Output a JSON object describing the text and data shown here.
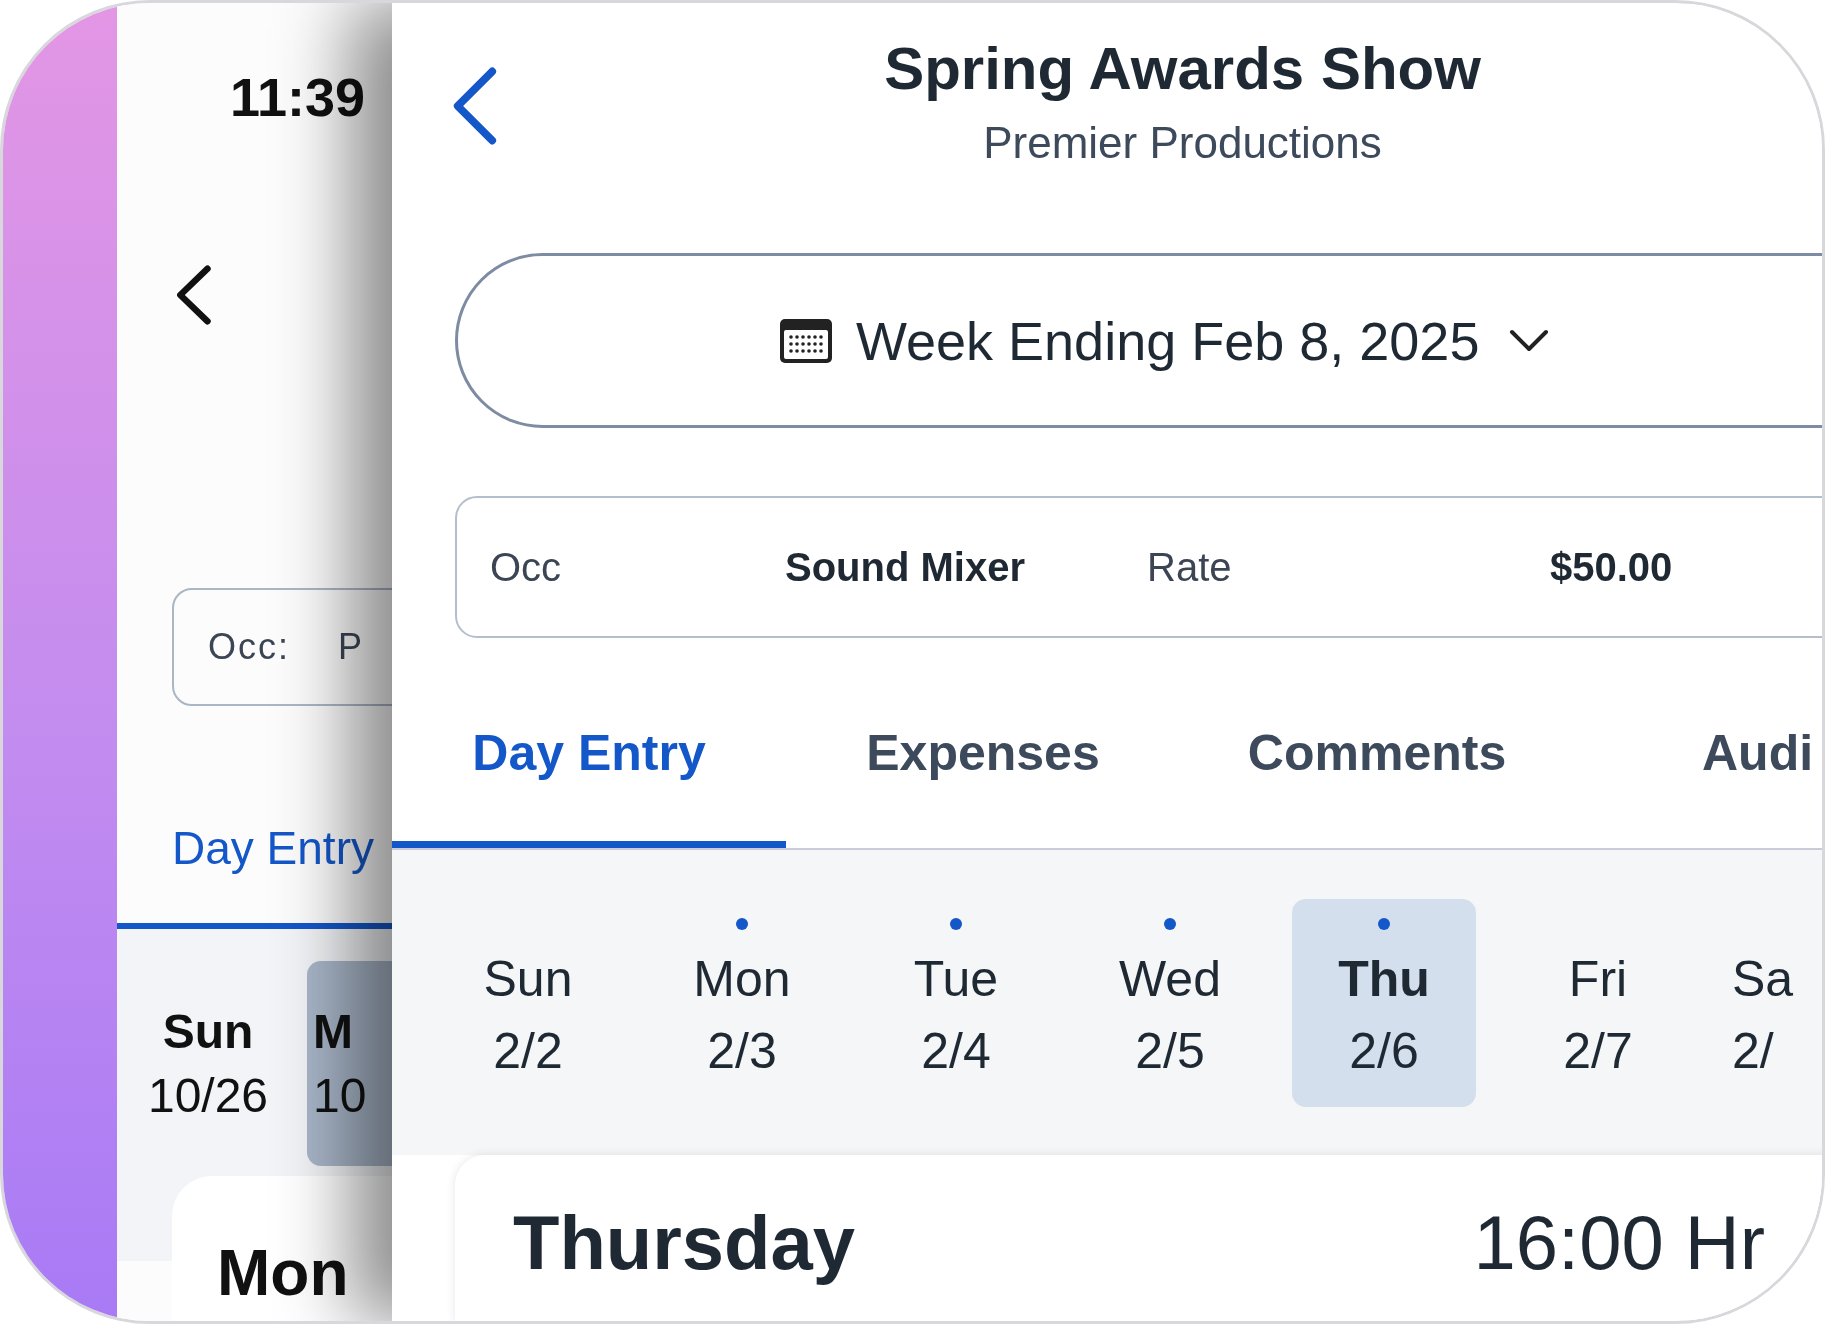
{
  "back_screen": {
    "time": "11:39",
    "occ_label": "Occ:",
    "occ_value": "P",
    "active_tab": "Day Entry",
    "days": [
      {
        "name": "Sun",
        "date": "10/26",
        "selected": false
      },
      {
        "name": "M",
        "date": "10",
        "selected": true
      }
    ],
    "card_title": "Mon"
  },
  "header": {
    "title": "Spring Awards Show",
    "subtitle": "Premier Productions"
  },
  "week_selector": {
    "label": "Week Ending Feb 8, 2025"
  },
  "assignment": {
    "occ_label": "Occ",
    "occ_value": "Sound Mixer",
    "rate_label": "Rate",
    "rate_value": "$50.00"
  },
  "tabs": [
    {
      "label": "Day Entry",
      "selected": true
    },
    {
      "label": "Expenses",
      "selected": false
    },
    {
      "label": "Comments",
      "selected": false
    },
    {
      "label": "Audi",
      "selected": false
    }
  ],
  "days": [
    {
      "name": "Sun",
      "date": "2/2",
      "has_entry": false,
      "selected": false
    },
    {
      "name": "Mon",
      "date": "2/3",
      "has_entry": true,
      "selected": false
    },
    {
      "name": "Tue",
      "date": "2/4",
      "has_entry": true,
      "selected": false
    },
    {
      "name": "Wed",
      "date": "2/5",
      "has_entry": true,
      "selected": false
    },
    {
      "name": "Thu",
      "date": "2/6",
      "has_entry": true,
      "selected": true
    },
    {
      "name": "Fri",
      "date": "2/7",
      "has_entry": false,
      "selected": false
    },
    {
      "name": "Sa",
      "date": "2/",
      "has_entry": false,
      "selected": false
    }
  ],
  "day_card": {
    "title": "Thursday",
    "hours": "16:00 Hr"
  }
}
